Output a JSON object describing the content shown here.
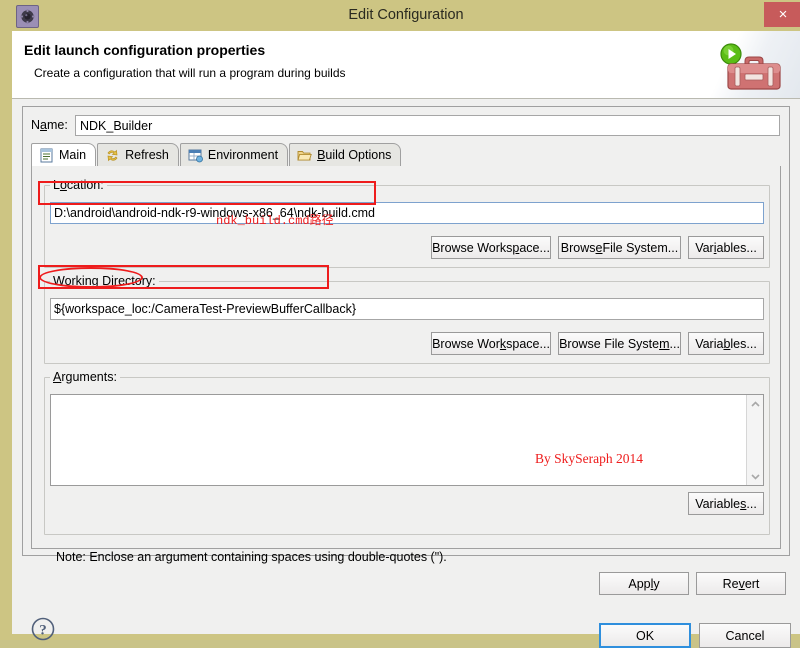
{
  "window": {
    "title": "Edit Configuration",
    "icon": "gear-icon",
    "close_label": "×",
    "titlebar_color": "#cdc583",
    "close_color": "#c75b5b"
  },
  "banner": {
    "title": "Edit launch configuration properties",
    "subtitle": "Create a configuration that will run a program during builds",
    "icon": "toolbox-run-icon"
  },
  "name_field": {
    "label_pre": "N",
    "label_mnemonic": "a",
    "label_post": "me:",
    "value": "NDK_Builder"
  },
  "tabs": [
    {
      "label": "Main",
      "icon": "document-icon",
      "active": true,
      "mnemonic": ""
    },
    {
      "label": "Refresh",
      "icon": "refresh-arrows-icon",
      "active": false,
      "mnemonic": ""
    },
    {
      "label": "Environment",
      "icon": "environment-table-icon",
      "active": false,
      "mnemonic": ""
    },
    {
      "label": "Build Options",
      "icon": "folder-open-icon",
      "active": false,
      "mnemonic": "B"
    }
  ],
  "location": {
    "legend_pre": "L",
    "legend_mnemonic": "o",
    "legend_post": "cation:",
    "value": "D:\\android\\android-ndk-r9-windows-x86_64\\ndk-build.cmd",
    "buttons": [
      {
        "pre": "Browse Works",
        "mn": "p",
        "post": "ace..."
      },
      {
        "pre": "Brows",
        "mn": "e",
        "post": " File System..."
      },
      {
        "pre": "Var",
        "mn": "i",
        "post": "ables..."
      }
    ]
  },
  "working_directory": {
    "legend_pre": "Working ",
    "legend_mnemonic": "D",
    "legend_post": "irectory:",
    "value": "${workspace_loc:/CameraTest-PreviewBufferCallback}",
    "buttons": [
      {
        "pre": "Browse Wor",
        "mn": "k",
        "post": "space..."
      },
      {
        "pre": "Browse File Syste",
        "mn": "m",
        "post": "..."
      },
      {
        "pre": "Varia",
        "mn": "b",
        "post": "les..."
      }
    ]
  },
  "arguments": {
    "legend_pre": "",
    "legend_mnemonic": "A",
    "legend_post": "rguments:",
    "value": "",
    "watermark": "By SkySeraph 2014",
    "variables_button": {
      "pre": "Variable",
      "mn": "s",
      "post": "..."
    },
    "note": "Note: Enclose an argument containing spaces using double-quotes (\").",
    "scroll_up_icon": "chevron-up-icon",
    "scroll_down_icon": "chevron-down-icon"
  },
  "footer": {
    "help_icon": "help-question-icon",
    "buttons": [
      {
        "name": "apply",
        "pre": "App",
        "mn": "l",
        "post": "y",
        "focus": false
      },
      {
        "name": "revert",
        "pre": "Re",
        "mn": "v",
        "post": "ert",
        "focus": false
      },
      {
        "name": "ok",
        "pre": "OK",
        "mn": "",
        "post": "",
        "focus": true
      },
      {
        "name": "cancel",
        "pre": "Cancel",
        "mn": "",
        "post": "",
        "focus": false
      }
    ]
  },
  "annotations": {
    "location_note": "ndk_build.cmd路径",
    "color": "#ee1c1c"
  }
}
